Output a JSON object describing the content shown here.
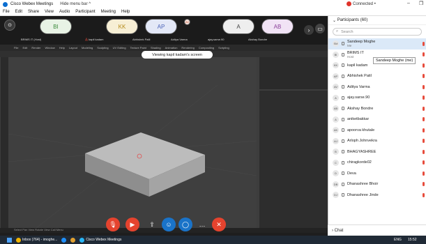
{
  "window": {
    "title": "Cisco Webex Meetings",
    "hide_menu": "Hide menu bar ^",
    "connection": "Connected •"
  },
  "menu": [
    "File",
    "Edit",
    "Share",
    "View",
    "Audio",
    "Participant",
    "Meeting",
    "Help"
  ],
  "tiles": [
    {
      "initials": "BI",
      "label": "BRIMS IT (Host)"
    },
    {
      "initials": "KK",
      "label": "kapil kadam"
    },
    {
      "initials": "AP",
      "label": "Abhishek Patil"
    },
    {
      "initials": "AV",
      "label": "Aditya Varma"
    },
    {
      "initials": "A",
      "label": "ajay.sarse.90"
    },
    {
      "initials": "AB",
      "label": "Akshay Bondre"
    }
  ],
  "share": {
    "banner": "Viewing kapil kadam's screen",
    "blender_menu": [
      "File",
      "Edit",
      "Render",
      "Window",
      "Help",
      "Layout",
      "Modeling",
      "Sculpting",
      "UV Editing",
      "Texture Paint",
      "Shading",
      "Animation",
      "Rendering",
      "Compositing",
      "Scripting"
    ],
    "status": "Select   Pan View   Rotate View   Call Menu"
  },
  "participants": {
    "header": "Participants (60)",
    "search_placeholder": "Search",
    "tooltip": "Sandeep Moghe (me)",
    "list": [
      {
        "initials": "SM",
        "name": "Sandeep Moghe",
        "sub": "Me"
      },
      {
        "initials": "BI",
        "name": "BRIMS IT",
        "sub": "Host"
      },
      {
        "initials": "KK",
        "name": "kapil kadam",
        "sub": ""
      },
      {
        "initials": "AP",
        "name": "Abhishek Patil",
        "sub": ""
      },
      {
        "initials": "AV",
        "name": "Aditya Varma",
        "sub": ""
      },
      {
        "initials": "A",
        "name": "ajay.sarse.90",
        "sub": ""
      },
      {
        "initials": "AB",
        "name": "Akshay Bondre",
        "sub": ""
      },
      {
        "initials": "A",
        "name": "aniketbakkar",
        "sub": ""
      },
      {
        "initials": "AK",
        "name": "apoorva khutale",
        "sub": ""
      },
      {
        "initials": "AJ",
        "name": "Arloph Johnvekra",
        "sub": ""
      },
      {
        "initials": "B",
        "name": "BHAGYASHREE",
        "sub": ""
      },
      {
        "initials": "C",
        "name": "chiragkorde02",
        "sub": ""
      },
      {
        "initials": "D",
        "name": "Deva",
        "sub": ""
      },
      {
        "initials": "DB",
        "name": "Dhanashree Bhoir",
        "sub": ""
      },
      {
        "initials": "DJ",
        "name": "Dhanashree Jinde",
        "sub": ""
      }
    ],
    "chat": "Chat"
  },
  "taskbar": {
    "items": [
      "Inbox (764) - imoghe...",
      "Cisco Webex Meetings"
    ],
    "lang": "ENG",
    "time": "15:52"
  }
}
